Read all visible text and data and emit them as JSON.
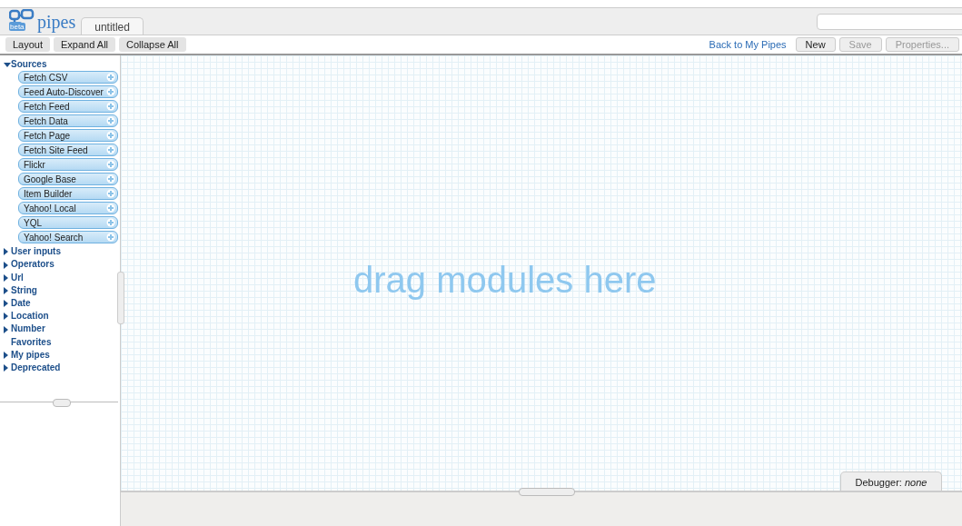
{
  "logo": {
    "text": "pipes",
    "badge": "beta"
  },
  "tab": {
    "label": "untitled",
    "selected": true
  },
  "toolbar": {
    "left": [
      "Layout",
      "Expand All",
      "Collapse All"
    ],
    "link": "Back to My Pipes",
    "buttons": [
      {
        "label": "New",
        "disabled": false
      },
      {
        "label": "Save",
        "disabled": true
      },
      {
        "label": "Properties...",
        "disabled": true
      }
    ]
  },
  "sidebar": {
    "categories": [
      {
        "label": "Sources",
        "expandable": true,
        "expanded": true,
        "children": [
          {
            "label": "Fetch CSV"
          },
          {
            "label": "Feed Auto-Discover"
          },
          {
            "label": "Fetch Feed"
          },
          {
            "label": "Fetch Data"
          },
          {
            "label": "Fetch Page"
          },
          {
            "label": "Fetch Site Feed"
          },
          {
            "label": "Flickr"
          },
          {
            "label": "Google Base"
          },
          {
            "label": "Item Builder"
          },
          {
            "label": "Yahoo! Local"
          },
          {
            "label": "YQL"
          },
          {
            "label": "Yahoo! Search"
          }
        ]
      },
      {
        "label": "User inputs",
        "expandable": true,
        "expanded": false
      },
      {
        "label": "Operators",
        "expandable": true,
        "expanded": false
      },
      {
        "label": "Url",
        "expandable": true,
        "expanded": false
      },
      {
        "label": "String",
        "expandable": true,
        "expanded": false
      },
      {
        "label": "Date",
        "expandable": true,
        "expanded": false
      },
      {
        "label": "Location",
        "expandable": true,
        "expanded": false
      },
      {
        "label": "Number",
        "expandable": true,
        "expanded": false
      },
      {
        "label": "Favorites",
        "expandable": false
      },
      {
        "label": "My pipes",
        "expandable": true,
        "expanded": false
      },
      {
        "label": "Deprecated",
        "expandable": true,
        "expanded": false
      }
    ]
  },
  "canvas": {
    "hint": "drag modules here"
  },
  "debugger": {
    "label": "Debugger: *none*"
  }
}
